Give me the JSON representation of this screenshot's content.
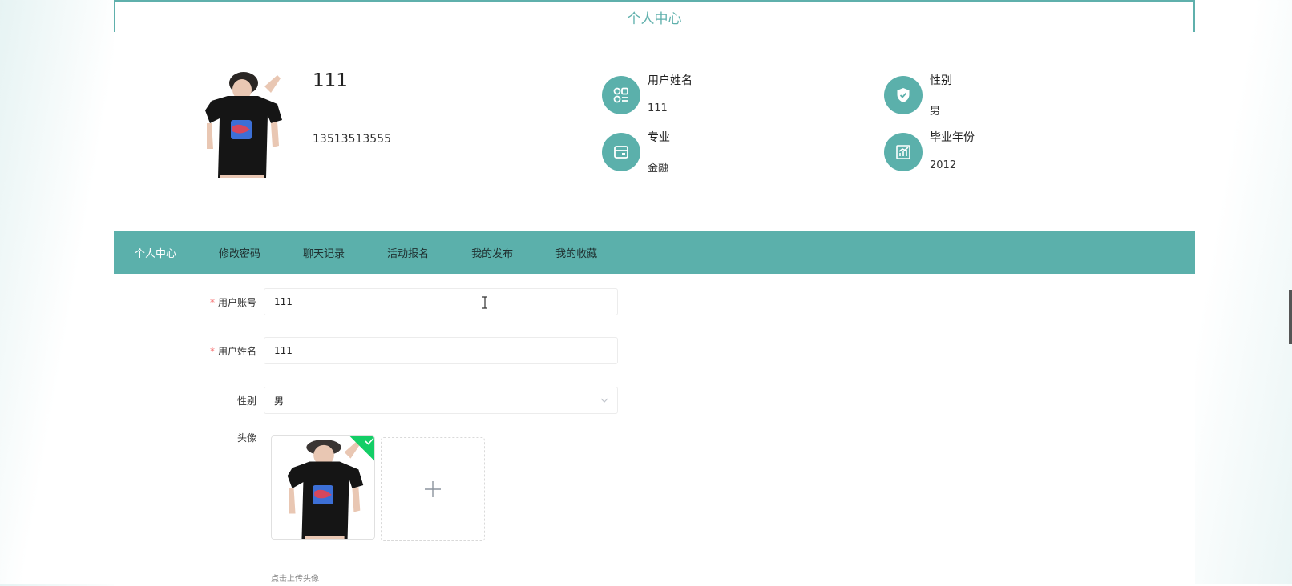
{
  "header": {
    "title": "个人中心"
  },
  "profile": {
    "name": "111",
    "phone": "13513513555",
    "fields": [
      {
        "label": "用户姓名",
        "value": "111",
        "icon": "apps-grid-icon"
      },
      {
        "label": "性别",
        "value": "男",
        "icon": "shield-check-icon"
      },
      {
        "label": "专业",
        "value": "金融",
        "icon": "wallet-card-icon"
      },
      {
        "label": "毕业年份",
        "value": "2012",
        "icon": "bar-chart-icon"
      }
    ]
  },
  "nav": {
    "tabs": [
      {
        "label": "个人中心",
        "active": true
      },
      {
        "label": "修改密码"
      },
      {
        "label": "聊天记录"
      },
      {
        "label": "活动报名"
      },
      {
        "label": "我的发布"
      },
      {
        "label": "我的收藏"
      }
    ]
  },
  "form": {
    "account": {
      "required": "*",
      "label": "用户账号",
      "value": "111"
    },
    "name": {
      "required": "*",
      "label": "用户姓名",
      "value": "111"
    },
    "gender": {
      "label": "性别",
      "value": "男"
    },
    "avatar": {
      "label": "头像",
      "hint": "点击上传头像"
    }
  },
  "colors": {
    "accent": "#5bb0ab",
    "title": "#5fb0ac",
    "required": "#f56c6c",
    "success": "#13ce66"
  }
}
